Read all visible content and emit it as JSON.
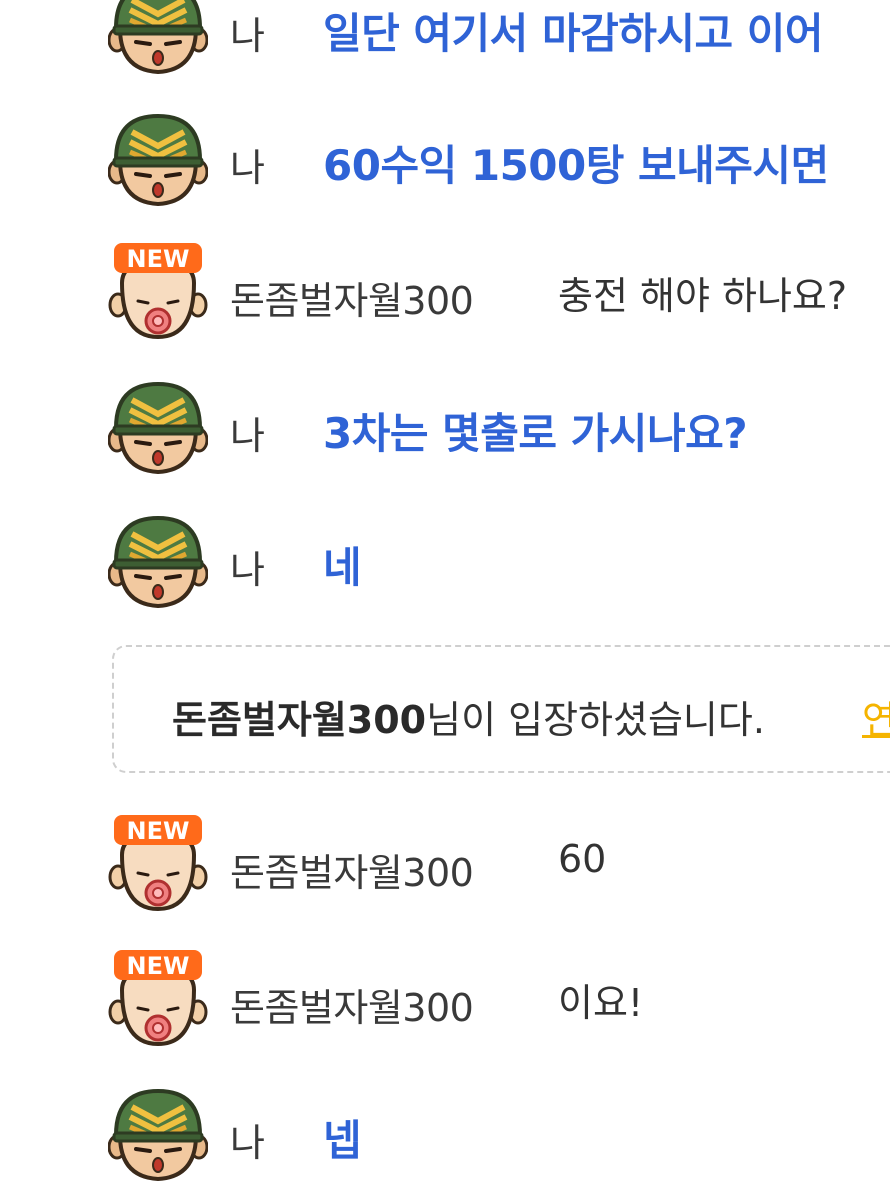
{
  "messages": [
    {
      "sender": "me",
      "nick": "나",
      "text": "일단 여기서 마감하시고 이어"
    },
    {
      "sender": "me",
      "nick": "나",
      "text": "60수익 1500탕 보내주시면"
    },
    {
      "sender": "other",
      "nick": "돈좀벌자월300",
      "text": "충전 해야 하나요?",
      "badge": "NEW"
    },
    {
      "sender": "me",
      "nick": "나",
      "text": "3차는 몇출로 가시나요?"
    },
    {
      "sender": "me",
      "nick": "나",
      "text": "네"
    },
    {
      "sender": "other",
      "nick": "돈좀벌자월300",
      "text": "60",
      "badge": "NEW"
    },
    {
      "sender": "other",
      "nick": "돈좀벌자월300",
      "text": "이요!",
      "badge": "NEW"
    },
    {
      "sender": "me",
      "nick": "나",
      "text": "넵"
    }
  ],
  "system_notice": {
    "name": "돈좀벌자월300",
    "suffix": "님이 입장하셨습니다.",
    "link": "연"
  },
  "colors": {
    "my_text": "#2f63d6",
    "other_text": "#333333",
    "link": "#f5b400",
    "badge": "#ff6a1a"
  },
  "icons": {
    "my_avatar": "soldier-helmet-avatar-icon",
    "other_avatar": "baby-pacifier-new-avatar-icon"
  }
}
